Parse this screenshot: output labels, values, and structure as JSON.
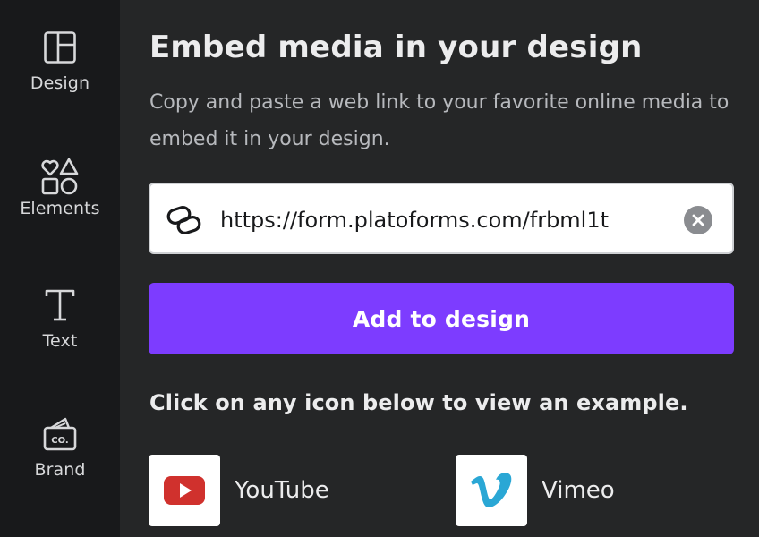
{
  "sidebar": {
    "items": [
      {
        "label": "Design",
        "icon": "layout-icon"
      },
      {
        "label": "Elements",
        "icon": "shapes-icon"
      },
      {
        "label": "Text",
        "icon": "text-t-icon"
      },
      {
        "label": "Brand",
        "icon": "brand-kit-icon"
      }
    ]
  },
  "main": {
    "title": "Embed media in your design",
    "description": "Copy and paste a web link to your favorite online media to embed it in your design.",
    "url_input": {
      "value": "https://form.platoforms.com/frbml1t"
    },
    "add_button_label": "Add to design",
    "hint": "Click on any icon below to view an example.",
    "providers": [
      {
        "name": "YouTube",
        "icon": "youtube-icon"
      },
      {
        "name": "Vimeo",
        "icon": "vimeo-icon"
      }
    ]
  },
  "colors": {
    "accent": "#7d3cff",
    "sidebar_bg": "#18191b",
    "panel_bg": "#252627",
    "youtube_red": "#d0312d",
    "vimeo_blue": "#2aa7d5"
  }
}
